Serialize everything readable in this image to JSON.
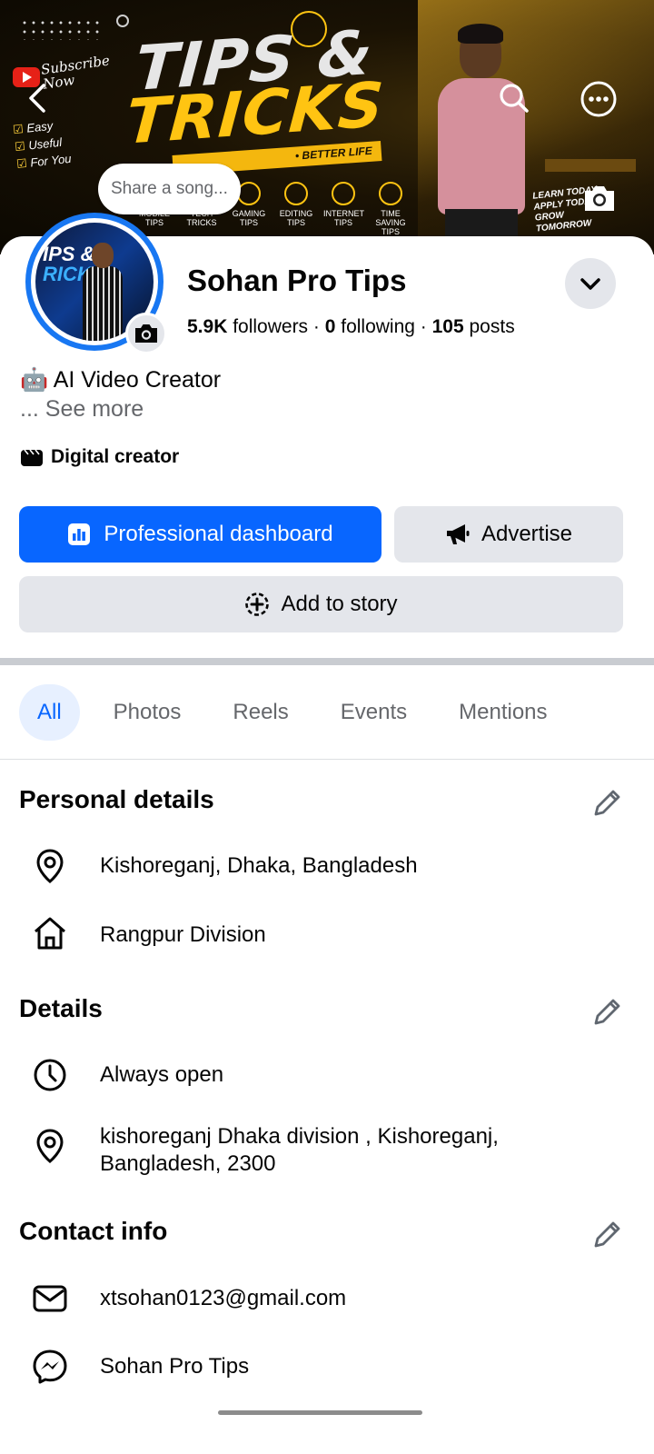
{
  "cover": {
    "subscribe": "Subscribe Now",
    "checklist": [
      "Easy",
      "Useful",
      "For You"
    ],
    "title_line1": "TIPS &",
    "title_line2": "TRICKS",
    "band_text": "• BETTER LIFE",
    "icons": [
      {
        "label": "MOBILE TIPS"
      },
      {
        "label": "TECH TRICKS"
      },
      {
        "label": "GAMING TIPS"
      },
      {
        "label": "EDITING TIPS"
      },
      {
        "label": "INTERNET TIPS"
      },
      {
        "label": "TIME SAVING TIPS"
      }
    ],
    "learn_today": "LEARN TODAY APPLY TODAY GROW TOMORROW",
    "accent_color": "#ffc412"
  },
  "song_bubble": "Share a song...",
  "profile": {
    "name": "Sohan Pro Tips",
    "followers_count": "5.9K",
    "followers_label": " followers · ",
    "following_count": "0",
    "following_label": " following · ",
    "posts_count": "105",
    "posts_label": " posts",
    "bio": "🤖 AI Video Creator",
    "see_more": "... See more",
    "category": "Digital creator"
  },
  "actions": {
    "dashboard": "Professional dashboard",
    "advertise": "Advertise",
    "add_story": "Add to story",
    "primary_color": "#0866ff"
  },
  "tabs": [
    {
      "label": "All",
      "active": true
    },
    {
      "label": "Photos"
    },
    {
      "label": "Reels"
    },
    {
      "label": "Events"
    },
    {
      "label": "Mentions"
    }
  ],
  "personal_details": {
    "title": "Personal details",
    "location": "Kishoreganj, Dhaka, Bangladesh",
    "hometown": "Rangpur Division"
  },
  "details": {
    "title": "Details",
    "hours": "Always open",
    "address": "kishoreganj Dhaka division , Kishoreganj, Bangladesh, 2300"
  },
  "contact": {
    "title": "Contact info",
    "email": "xtsohan0123@gmail.com",
    "messenger": "Sohan Pro Tips"
  },
  "icons": {
    "back": "back-arrow-icon",
    "search": "search-icon",
    "more": "more-icon",
    "camera": "camera-icon",
    "chevron": "chevron-down-icon",
    "pin": "location-pin-icon",
    "home": "home-icon",
    "clock": "clock-icon",
    "mail": "mail-icon",
    "messenger": "messenger-icon",
    "pencil": "pencil-icon"
  }
}
